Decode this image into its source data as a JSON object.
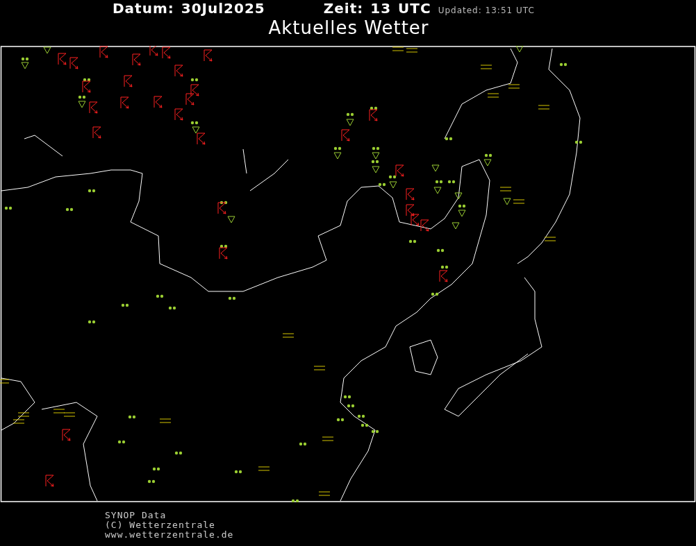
{
  "header": {
    "date_label": "Datum:",
    "date": "30Jul2025",
    "time_label": "Zeit:",
    "time": "13",
    "time_unit": "UTC",
    "updated": "Updated: 13:51 UTC"
  },
  "title": "Aktuelles Wetter",
  "footer": [
    "SYNOP Data",
    "(C) Wetterzentrale",
    "www.wetterzentrale.de"
  ]
}
